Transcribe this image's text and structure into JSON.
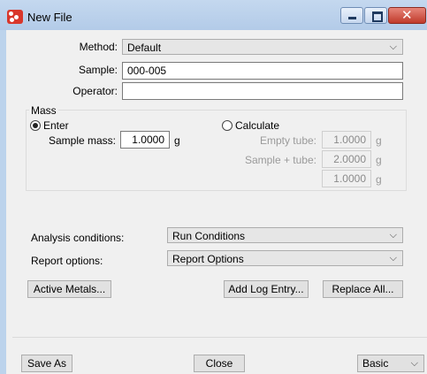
{
  "window": {
    "title": "New File"
  },
  "form": {
    "method": {
      "label": "Method:",
      "value": "Default"
    },
    "sample": {
      "label": "Sample:",
      "value": "000-005"
    },
    "operator": {
      "label": "Operator:",
      "value": ""
    }
  },
  "mass": {
    "legend": "Mass",
    "enter": {
      "label": "Enter",
      "selected": true
    },
    "calculate": {
      "label": "Calculate",
      "selected": false
    },
    "sample_mass": {
      "label": "Sample mass:",
      "value": "1.0000",
      "unit": "g"
    },
    "empty_tube": {
      "label": "Empty tube:",
      "value": "1.0000",
      "unit": "g"
    },
    "sample_tube": {
      "label": "Sample + tube:",
      "value": "2.0000",
      "unit": "g"
    },
    "result": {
      "value": "1.0000",
      "unit": "g"
    }
  },
  "conditions": {
    "analysis_label": "Analysis conditions:",
    "analysis_value": "Run Conditions",
    "report_label": "Report options:",
    "report_value": "Report Options"
  },
  "buttons": {
    "active_metals": "Active Metals...",
    "add_log_entry": "Add Log Entry...",
    "replace_all": "Replace All...",
    "save_as": "Save As",
    "close": "Close"
  },
  "mode": {
    "value": "Basic"
  },
  "icons": {
    "dropdown": "chevron-down-icon",
    "close_glyph": "✕",
    "chevron_glyph": "⌵"
  }
}
